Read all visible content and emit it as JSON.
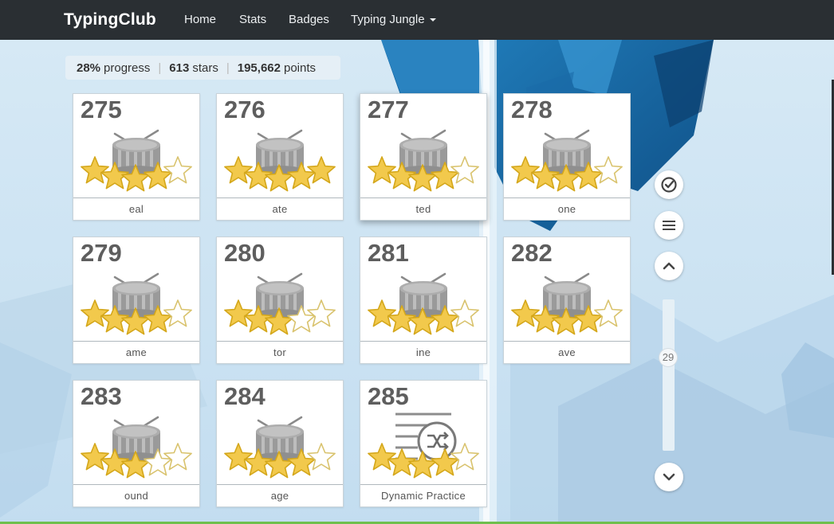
{
  "nav": {
    "brand": "TypingClub",
    "links": [
      "Home",
      "Stats",
      "Badges",
      "Typing Jungle"
    ]
  },
  "summary": {
    "progress_value": "28%",
    "progress_label": "progress",
    "stars_value": "613",
    "stars_label": "stars",
    "points_value": "195,662",
    "points_label": "points"
  },
  "lessons": [
    {
      "number": "275",
      "label": "eal",
      "stars": 4,
      "icon": "drum-icon"
    },
    {
      "number": "276",
      "label": "ate",
      "stars": 5,
      "icon": "drum-icon"
    },
    {
      "number": "277",
      "label": "ted",
      "stars": 4,
      "icon": "drum-icon",
      "active": true
    },
    {
      "number": "278",
      "label": "one",
      "stars": 4,
      "icon": "drum-icon"
    },
    {
      "number": "279",
      "label": "ame",
      "stars": 4,
      "icon": "drum-icon"
    },
    {
      "number": "280",
      "label": "tor",
      "stars": 3,
      "icon": "drum-icon"
    },
    {
      "number": "281",
      "label": "ine",
      "stars": 4,
      "icon": "drum-icon"
    },
    {
      "number": "282",
      "label": "ave",
      "stars": 4,
      "icon": "drum-icon"
    },
    {
      "number": "283",
      "label": "ound",
      "stars": 3,
      "icon": "drum-icon"
    },
    {
      "number": "284",
      "label": "age",
      "stars": 4,
      "icon": "drum-icon"
    },
    {
      "number": "285",
      "label": "Dynamic Practice",
      "stars": 4,
      "icon": "shuffle-icon"
    }
  ],
  "side_controls": {
    "slider_value": "29",
    "icons": [
      "check-circle-icon",
      "menu-icon",
      "chevron-up-icon",
      "chevron-down-icon"
    ]
  },
  "colors": {
    "navbar": "#2a2f33",
    "star_fill": "#f2c94c",
    "drum_gray": "#9e9e9e"
  }
}
